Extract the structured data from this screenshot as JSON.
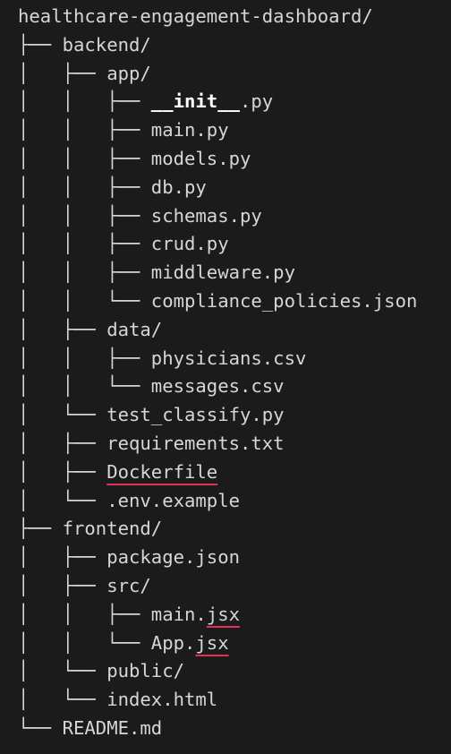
{
  "lines": [
    {
      "branch": "",
      "segs": [
        {
          "text": "healthcare-engagement-dashboard/"
        }
      ]
    },
    {
      "branch": "├── ",
      "segs": [
        {
          "text": "backend/"
        }
      ]
    },
    {
      "branch": "│   ├── ",
      "segs": [
        {
          "text": "app/"
        }
      ]
    },
    {
      "branch": "│   │   ├── ",
      "segs": [
        {
          "text": "__init__",
          "style": "bold"
        },
        {
          "text": ".py"
        }
      ]
    },
    {
      "branch": "│   │   ├── ",
      "segs": [
        {
          "text": "main.py"
        }
      ]
    },
    {
      "branch": "│   │   ├── ",
      "segs": [
        {
          "text": "models.py"
        }
      ]
    },
    {
      "branch": "│   │   ├── ",
      "segs": [
        {
          "text": "db.py"
        }
      ]
    },
    {
      "branch": "│   │   ├── ",
      "segs": [
        {
          "text": "schemas.py"
        }
      ]
    },
    {
      "branch": "│   │   ├── ",
      "segs": [
        {
          "text": "crud.py"
        }
      ]
    },
    {
      "branch": "│   │   ├── ",
      "segs": [
        {
          "text": "middleware.py"
        }
      ]
    },
    {
      "branch": "│   │   └── ",
      "segs": [
        {
          "text": "compliance_policies.json"
        }
      ]
    },
    {
      "branch": "│   ├── ",
      "segs": [
        {
          "text": "data/"
        }
      ]
    },
    {
      "branch": "│   │   ├── ",
      "segs": [
        {
          "text": "physicians.csv"
        }
      ]
    },
    {
      "branch": "│   │   └── ",
      "segs": [
        {
          "text": "messages.csv"
        }
      ]
    },
    {
      "branch": "│   └── ",
      "segs": [
        {
          "text": "test_classify.py"
        }
      ]
    },
    {
      "branch": "│   ├── ",
      "segs": [
        {
          "text": "requirements.txt"
        }
      ]
    },
    {
      "branch": "│   ├── ",
      "segs": [
        {
          "text": "Dockerfile",
          "style": "squiggle"
        }
      ]
    },
    {
      "branch": "│   └── ",
      "segs": [
        {
          "text": ".env.example"
        }
      ]
    },
    {
      "branch": "├── ",
      "segs": [
        {
          "text": "frontend/"
        }
      ]
    },
    {
      "branch": "│   ├── ",
      "segs": [
        {
          "text": "package.json"
        }
      ]
    },
    {
      "branch": "│   ├── ",
      "segs": [
        {
          "text": "src/"
        }
      ]
    },
    {
      "branch": "│   │   ├── ",
      "segs": [
        {
          "text": "main."
        },
        {
          "text": "jsx",
          "style": "squiggle"
        }
      ]
    },
    {
      "branch": "│   │   └── ",
      "segs": [
        {
          "text": "App."
        },
        {
          "text": "jsx",
          "style": "squiggle"
        }
      ]
    },
    {
      "branch": "│   └── ",
      "segs": [
        {
          "text": "public/"
        }
      ]
    },
    {
      "branch": "│   └── ",
      "segs": [
        {
          "text": "index.html"
        }
      ]
    },
    {
      "branch": "└── ",
      "segs": [
        {
          "text": "README.md"
        }
      ]
    }
  ],
  "colors": {
    "background": "#1b1b1b",
    "text": "#d6d6d6",
    "bold_text": "#ffffff",
    "spellcheck_underline": "#e0305a"
  }
}
